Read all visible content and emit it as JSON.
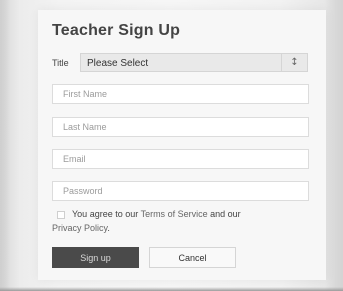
{
  "form": {
    "title": "Teacher Sign Up",
    "title_select": {
      "label": "Title",
      "selected": "Please Select",
      "arrow_icon": "up-down-arrows"
    },
    "fields": {
      "first_name": {
        "placeholder": "First Name",
        "value": ""
      },
      "last_name": {
        "placeholder": "Last Name",
        "value": ""
      },
      "email": {
        "placeholder": "Email",
        "value": ""
      },
      "password": {
        "placeholder": "Password",
        "value": ""
      }
    },
    "agreement": {
      "prefix": "You agree to our ",
      "terms_link": "Terms of Service",
      "middle": " and our",
      "privacy_link": "Privacy Policy",
      "suffix": "."
    },
    "buttons": {
      "signup": "Sign up",
      "cancel": "Cancel"
    }
  },
  "colors": {
    "primary_button": "#4a4a4a",
    "secondary_button": "#f9f9f9",
    "text": "#444444"
  }
}
